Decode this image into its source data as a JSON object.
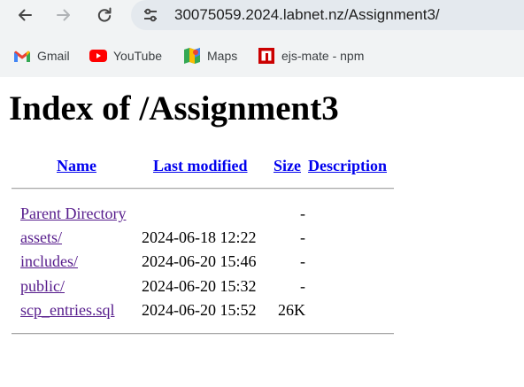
{
  "browser": {
    "url": "30075059.2024.labnet.nz/Assignment3/",
    "bookmarks": [
      {
        "label": "Gmail",
        "icon": "gmail-icon"
      },
      {
        "label": "YouTube",
        "icon": "youtube-icon"
      },
      {
        "label": "Maps",
        "icon": "maps-icon"
      },
      {
        "label": "ejs-mate - npm",
        "icon": "npm-icon"
      }
    ]
  },
  "page": {
    "title": "Index of /Assignment3",
    "headers": {
      "name": "Name",
      "last_modified": "Last modified",
      "size": "Size",
      "description": "Description"
    },
    "rows": [
      {
        "name": "Parent Directory",
        "modified": "",
        "size": "-"
      },
      {
        "name": "assets/",
        "modified": "2024-06-18 12:22",
        "size": "-"
      },
      {
        "name": "includes/",
        "modified": "2024-06-20 15:46",
        "size": "-"
      },
      {
        "name": "public/",
        "modified": "2024-06-20 15:32",
        "size": "-"
      },
      {
        "name": "scp_entries.sql",
        "modified": "2024-06-20 15:52",
        "size": "26K"
      }
    ]
  },
  "colors": {
    "link": "#0000ee",
    "visited_link": "#551a8b",
    "chrome_background": "#f1f3f4",
    "omnibox_background": "#e4e9ee"
  }
}
